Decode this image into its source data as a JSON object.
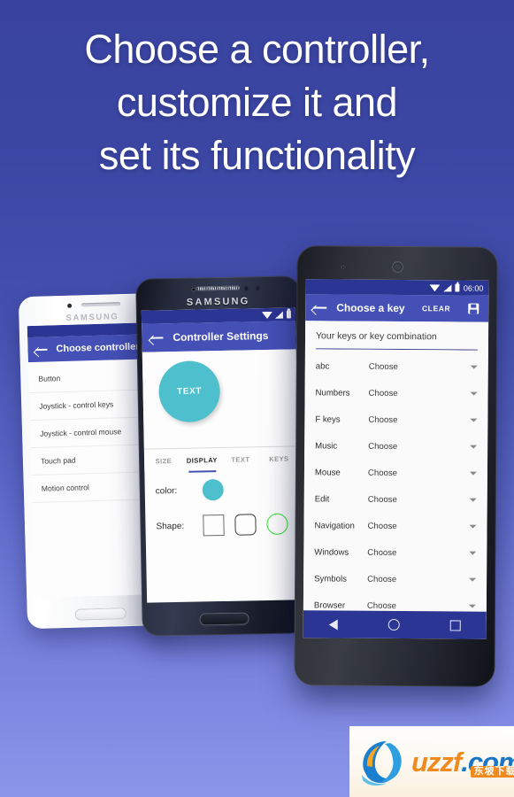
{
  "headline": {
    "line1": "Choose a controller,",
    "line2": "customize it and",
    "line3": "set its functionality"
  },
  "colors": {
    "background_top": "#3a44a0",
    "background_bottom": "#8b95e8",
    "appbar": "#4450b5",
    "statusbar": "#2b3593",
    "accent_teal": "#4ebfcc",
    "shape_selected_green": "#2ee02e",
    "watermark_orange": "#f08a1e",
    "watermark_blue": "#1976c5"
  },
  "phone_left": {
    "brand": "SAMSUNG",
    "appbar": {
      "back_icon": "back-arrow-icon",
      "title": "Choose controller"
    },
    "list": [
      "Button",
      "Joystick - control keys",
      "Joystick - control mouse",
      "Touch pad",
      "Motion control"
    ]
  },
  "phone_mid": {
    "brand": "SAMSUNG",
    "appbar": {
      "back_icon": "back-arrow-icon",
      "title": "Controller Settings"
    },
    "preview": {
      "button_label": "TEXT"
    },
    "tabs": [
      {
        "label": "SIZE",
        "active": false
      },
      {
        "label": "DISPLAY",
        "active": true
      },
      {
        "label": "TEXT",
        "active": false
      },
      {
        "label": "KEYS",
        "active": false
      }
    ],
    "color_row": {
      "label": "color:",
      "swatch": "#4ebfcc"
    },
    "shape_row": {
      "label": "Shape:",
      "options": [
        "square-shape",
        "rounded-square-shape",
        "circle-shape"
      ],
      "selected": "circle-shape"
    }
  },
  "phone_right": {
    "statusbar": {
      "wifi_icon": "wifi-icon",
      "signal_icon": "signal-icon",
      "battery_icon": "battery-icon",
      "clock": "06:00"
    },
    "appbar": {
      "back_icon": "back-arrow-icon",
      "title": "Choose a key",
      "clear_label": "CLEAR",
      "save_icon": "save-icon"
    },
    "key_field": {
      "hint": "Your keys or key combination",
      "value": ""
    },
    "choose_label": "Choose",
    "categories": [
      "abc",
      "Numbers",
      "F keys",
      "Music",
      "Mouse",
      "Edit",
      "Navigation",
      "Windows",
      "Symbols",
      "Browser"
    ],
    "navbar": {
      "back_icon": "nav-back-icon",
      "home_icon": "nav-home-icon",
      "recents_icon": "nav-recents-icon"
    }
  },
  "watermark": {
    "logo_icon": "uzzf-wave-logo-icon",
    "text_uzz": "uzzf",
    "text_com": ".com",
    "text_cn": "东坡下载"
  }
}
